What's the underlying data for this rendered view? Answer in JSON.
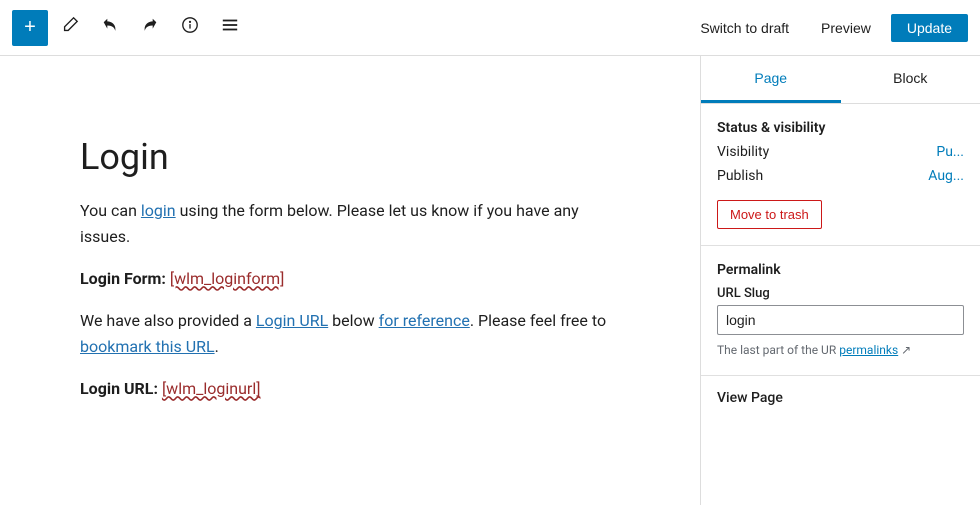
{
  "toolbar": {
    "add_label": "+",
    "switch_draft_label": "Switch to draft",
    "preview_label": "Preview",
    "update_label": "Update"
  },
  "editor": {
    "page_title": "Login",
    "paragraph1": "You can login using the form below. Please let us know if you have any issues.",
    "login_form_label": "Login Form:",
    "login_form_shortcode": "[wlm_loginform]",
    "paragraph2": "We have also provided a Login URL below for reference. Please feel free to bookmark this URL.",
    "login_url_label": "Login URL:",
    "login_url_shortcode": "[wlm_loginurl]"
  },
  "sidebar": {
    "tab_page": "Page",
    "tab_block": "Block",
    "status_visibility_label": "Status & visibility",
    "visibility_label": "Visibility",
    "visibility_value": "Pu...",
    "publish_label": "Publish",
    "publish_value": "Aug...",
    "move_to_trash_label": "Move to trash",
    "permalink_label": "Permalink",
    "url_slug_label": "URL Slug",
    "url_slug_value": "login",
    "permalink_desc": "The last part of the UR",
    "permalinks_link": "permalinks",
    "view_page_label": "View Page"
  },
  "icons": {
    "add": "+",
    "pen": "✎",
    "undo": "↩",
    "redo": "↪",
    "info": "ℹ",
    "menu": "≡"
  }
}
